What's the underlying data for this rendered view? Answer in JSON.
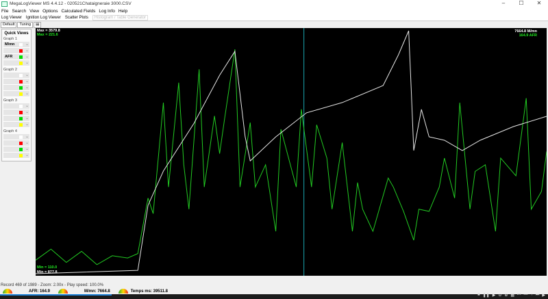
{
  "window": {
    "title": "MegaLogViewer MS 4.4.12 - 020521Chataigneraie 3000.CSV",
    "min": "–",
    "max": "☐",
    "close": "✕"
  },
  "menu": [
    "File",
    "Search",
    "View",
    "Options",
    "Calculated Fields",
    "Log Info",
    "Help"
  ],
  "tabs": [
    "Log Viewer",
    "Ignition Log Viewer",
    "Scatter Plots",
    "Histogram / Table Generator"
  ],
  "subtabs": [
    "Default",
    "Tuning",
    "▤"
  ],
  "sidebar": {
    "title": "Quick Views",
    "graphs": [
      {
        "label": "Graph 1",
        "rows": [
          {
            "field": "M/mn",
            "color": "#ffffff"
          },
          {
            "field": "",
            "color": "#ff0000"
          },
          {
            "field": "AFR",
            "color": "#00dd00"
          },
          {
            "field": "",
            "color": "#ffff00"
          }
        ]
      },
      {
        "label": "Graph 2",
        "rows": [
          {
            "field": "",
            "color": "#ffffff"
          },
          {
            "field": "",
            "color": "#ff0000"
          },
          {
            "field": "",
            "color": "#00dd00"
          },
          {
            "field": "",
            "color": "#ffff00"
          }
        ]
      },
      {
        "label": "Graph 3",
        "rows": [
          {
            "field": "",
            "color": "#ffffff"
          },
          {
            "field": "",
            "color": "#ff0000"
          },
          {
            "field": "",
            "color": "#00dd00"
          },
          {
            "field": "",
            "color": "#ffff00"
          }
        ]
      },
      {
        "label": "Graph 4",
        "rows": [
          {
            "field": "",
            "color": "#ffffff"
          },
          {
            "field": "",
            "color": "#ff0000"
          },
          {
            "field": "",
            "color": "#00dd00"
          },
          {
            "field": "",
            "color": "#ffff00"
          }
        ]
      }
    ]
  },
  "chart_data": {
    "type": "line",
    "cursor_index": 52.5,
    "series": [
      {
        "name": "M/mn",
        "color": "#e8e8e8",
        "min": 877.8,
        "max": 3579.8,
        "current": "7664.8",
        "x": [
          0,
          20,
          22,
          25,
          31,
          36,
          39,
          41,
          42,
          47,
          53,
          60,
          68,
          71,
          73,
          73.5,
          74,
          75.5,
          77,
          80,
          83.5,
          87,
          93.5,
          100
        ],
        "y": [
          900,
          937,
          1646,
          2020,
          2542,
          3065,
          3326,
          2393,
          2131,
          2393,
          2655,
          2767,
          2953,
          3289,
          3550,
          2916,
          2244,
          2692,
          2393,
          2356,
          2244,
          2356,
          2505,
          2617
        ]
      },
      {
        "name": "AFR",
        "color": "#22cc22",
        "min": 110,
        "max": 221.6,
        "current": "164.9",
        "x": [
          0,
          3,
          6,
          9,
          12,
          15,
          18,
          20,
          22,
          23,
          25,
          26,
          28,
          29,
          30,
          32,
          33,
          35,
          36,
          37,
          39,
          40,
          42,
          43,
          45,
          47,
          48,
          51,
          52,
          54,
          55,
          57,
          58,
          60,
          62,
          63,
          64,
          66,
          69,
          70,
          72,
          74,
          75,
          77,
          79,
          80,
          82,
          83,
          85,
          86,
          88,
          90,
          91,
          94,
          96,
          97,
          99,
          100
        ],
        "y": [
          117,
          122,
          116,
          121,
          115,
          119,
          118,
          120,
          145,
          138,
          188,
          150,
          197,
          160,
          140,
          203,
          150,
          182,
          165,
          181,
          212,
          150,
          179,
          150,
          160,
          130,
          176,
          150,
          185,
          150,
          178,
          163,
          140,
          170,
          130,
          152,
          140,
          130,
          154,
          150,
          139,
          126,
          140,
          139,
          150,
          163,
          145,
          188,
          140,
          157,
          160,
          130,
          163,
          155,
          190,
          140,
          148,
          166
        ]
      }
    ],
    "labels": {
      "max_white": "Max = 3579.8",
      "max_green": "Max = 221.6",
      "min_white": "Min = 877.8",
      "min_green": "Min = 110.0",
      "right_white": "7664.8  M/mn",
      "right_green": "164.9  AFR"
    }
  },
  "status": {
    "record": "Record 469 of 1989 - Zoom: 2.00x - Play speed: 100.0%",
    "gauges": [
      "AFR: 164.9",
      "M/mn: 7664.8",
      "Temps ms: 39511.8"
    ]
  },
  "controls": [
    "■",
    "❚❚",
    "▶",
    "⊖",
    "⊕",
    "▦",
    "⏮",
    "—",
    "+",
    "⏭",
    "▶"
  ]
}
